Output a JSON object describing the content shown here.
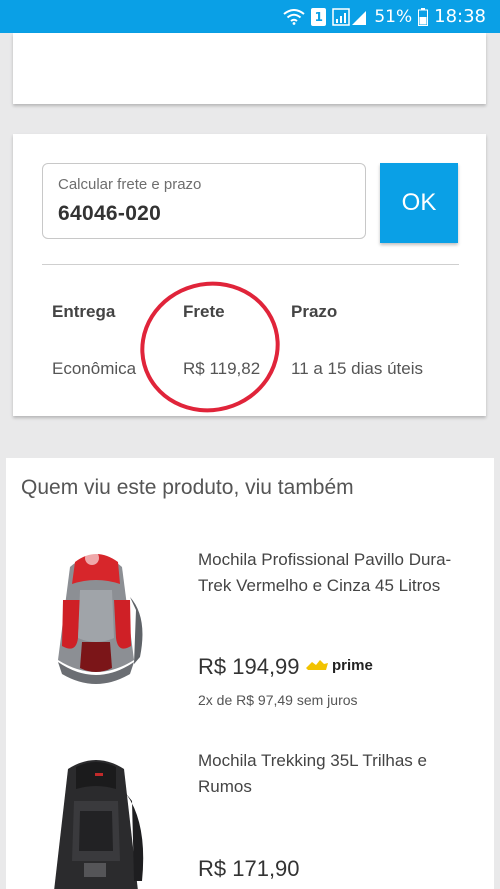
{
  "status_bar": {
    "icons": [
      "wifi-icon",
      "sim-icon",
      "signal-icon",
      "battery-icon"
    ],
    "sim_label": "1",
    "battery": "51%",
    "time": "18:38",
    "color": "#0aa0e6"
  },
  "shipping": {
    "zip_label": "Calcular frete e prazo",
    "zip_value": "64046-020",
    "ok_label": "OK",
    "headers": {
      "delivery": "Entrega",
      "freight": "Frete",
      "deadline": "Prazo"
    },
    "row": {
      "delivery": "Econômica",
      "freight": "R$ 119,82",
      "deadline": "11 a 15 dias úteis"
    },
    "highlight_color": "#e0243a"
  },
  "related": {
    "title": "Quem viu este produto, viu também",
    "products": [
      {
        "name": "Mochila Profissional Pavillo Dura-Trek Vermelho e Cinza 45 Litros",
        "price": "R$ 194,99",
        "prime_label": "prime",
        "installments": "2x de R$ 97,49 sem juros",
        "image": "red-gray-backpack"
      },
      {
        "name": "Mochila Trekking 35L Trilhas e Rumos",
        "price": "R$ 171,90",
        "image": "black-backpack"
      }
    ]
  },
  "accent_color": "#0aa0e6",
  "prime_color": "#f2c300"
}
